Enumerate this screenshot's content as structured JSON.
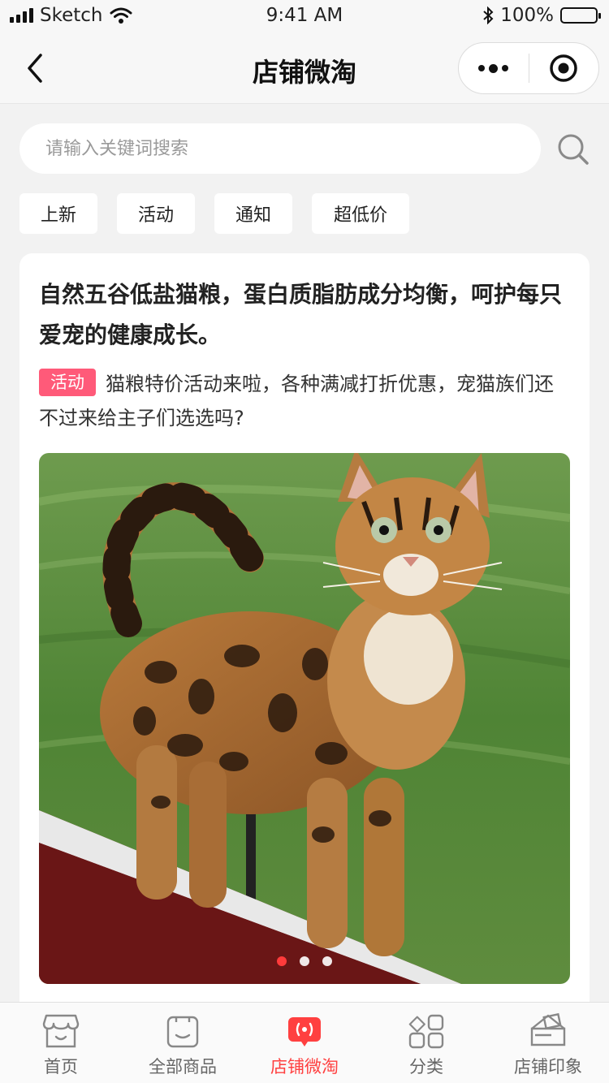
{
  "status_bar": {
    "carrier": "Sketch",
    "time": "9:41 AM",
    "battery": "100%"
  },
  "nav": {
    "title": "店铺微淘"
  },
  "search": {
    "placeholder": "请输入关键词搜索"
  },
  "tags": [
    "上新",
    "活动",
    "通知",
    "超低价"
  ],
  "post": {
    "headline": "自然五谷低盐猫粮，蛋白质脂肪成分均衡，呵护每只爱宠的健康成长。",
    "badge": "活动",
    "description": "猫粮特价活动来啦，各种满减打折优惠，宠猫族们还不过来给主子们选选吗?",
    "image_subject": "bengal-cat-photo",
    "carousel_count": 3,
    "carousel_active_index": 0
  },
  "tab_bar": {
    "items": [
      {
        "label": "首页",
        "icon": "storefront-icon"
      },
      {
        "label": "全部商品",
        "icon": "shopping-bag-icon"
      },
      {
        "label": "店铺微淘",
        "icon": "broadcast-icon",
        "active": true
      },
      {
        "label": "分类",
        "icon": "category-grid-icon"
      },
      {
        "label": "店铺印象",
        "icon": "shop-impression-icon"
      }
    ]
  },
  "colors": {
    "accent": "#ff4040",
    "badge": "#ff5a79",
    "background": "#f2f2f2"
  }
}
